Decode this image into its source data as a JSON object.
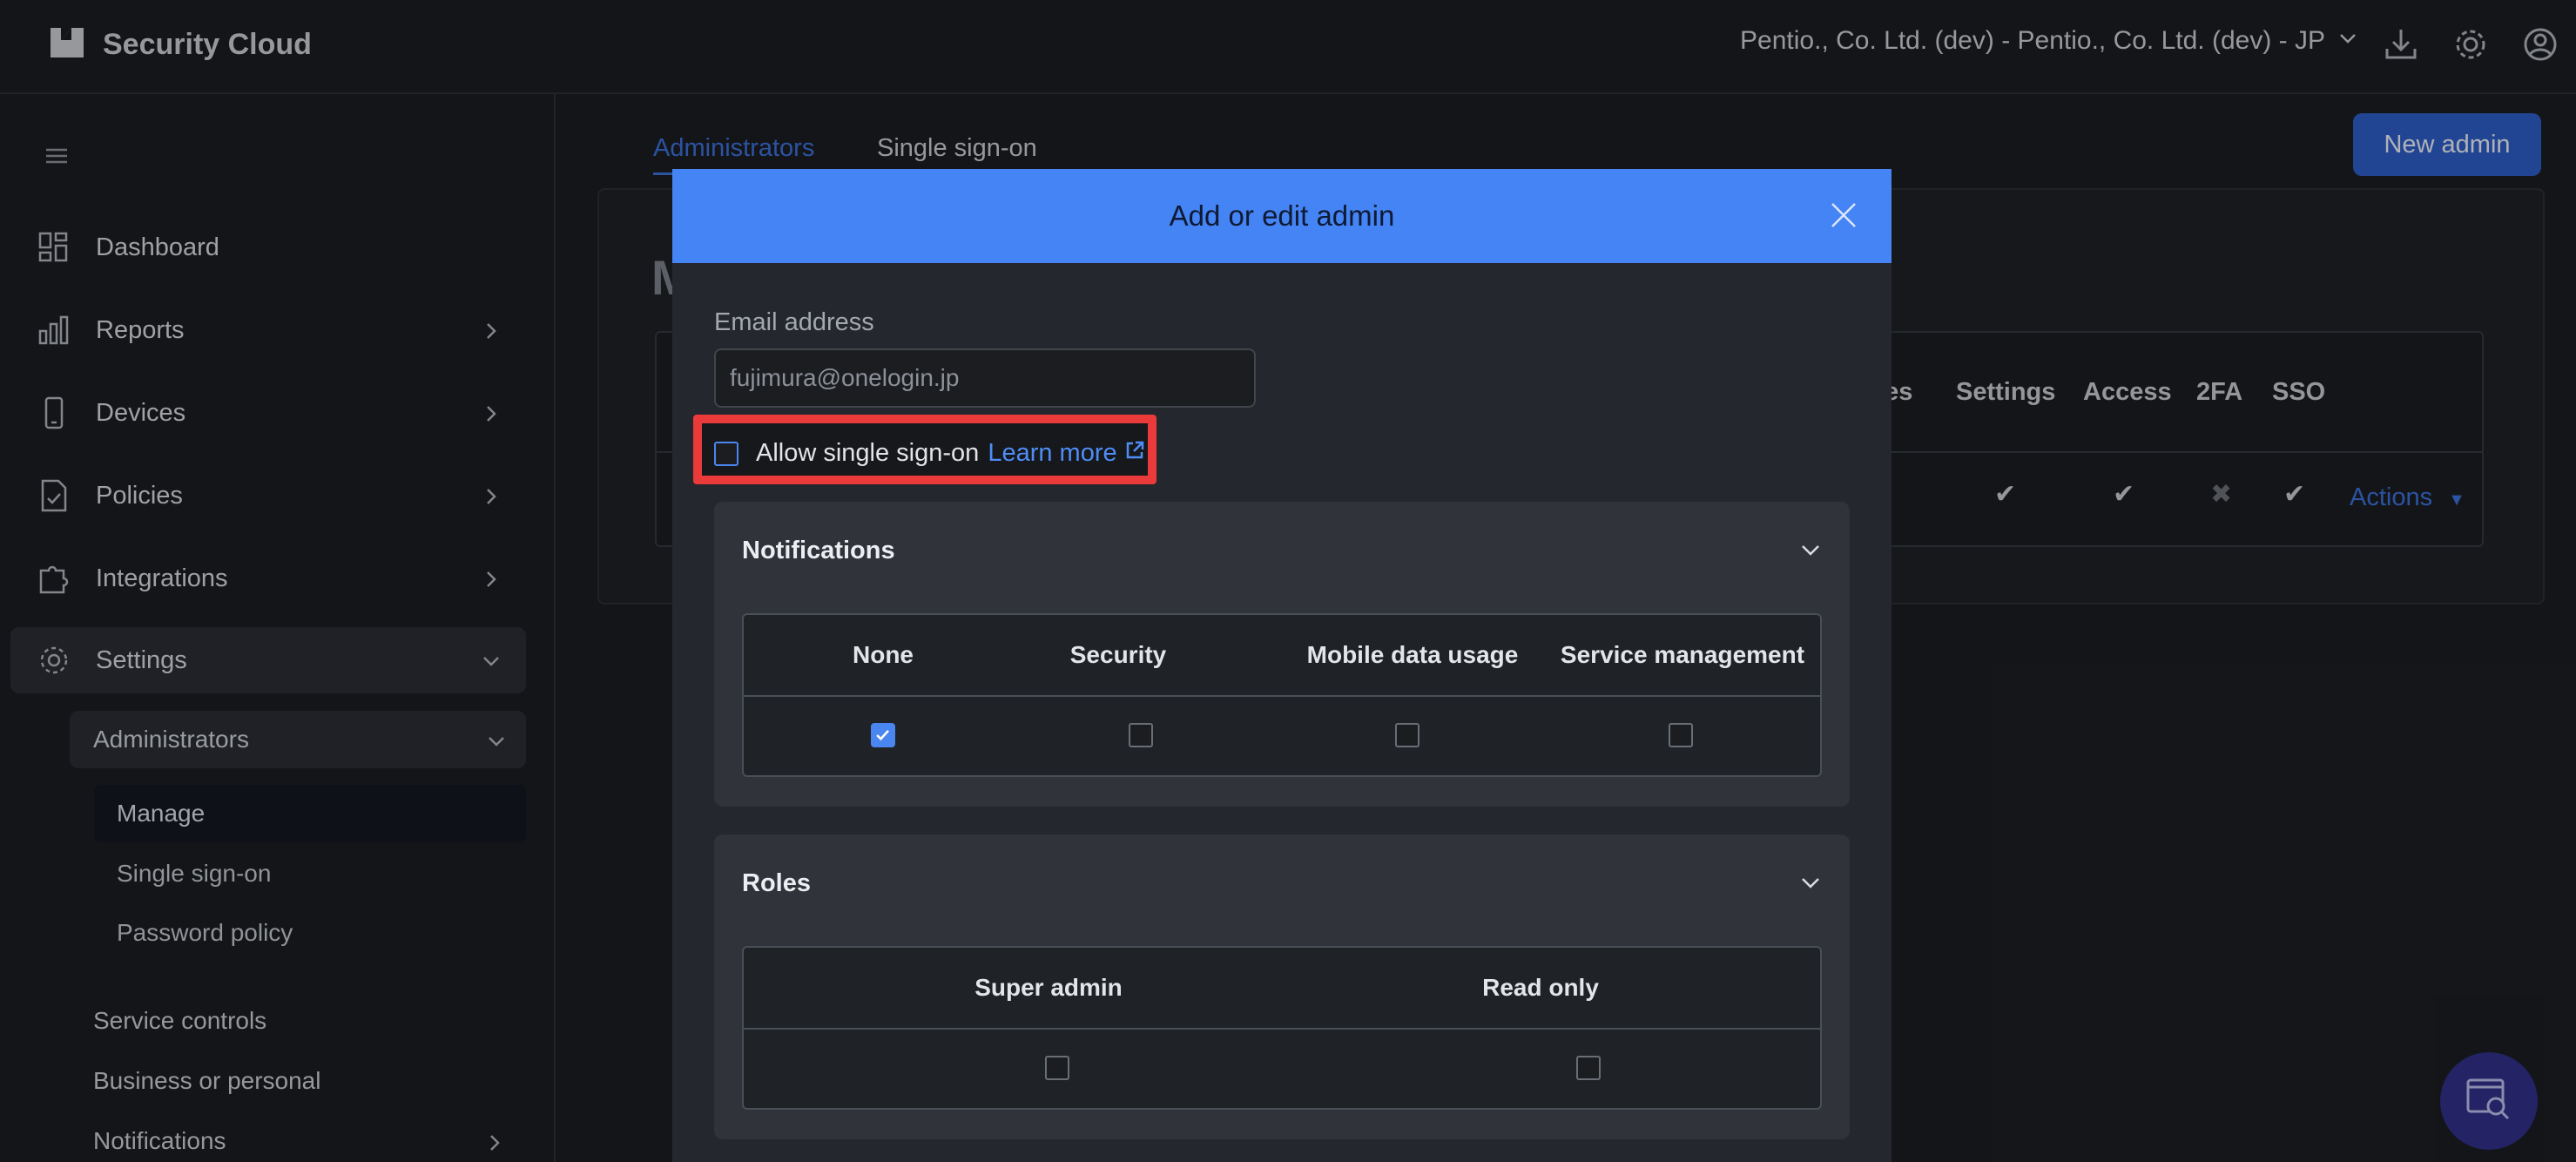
{
  "topbar": {
    "brand": "Security Cloud",
    "org_label": "Pentio., Co. Ltd. (dev) - Pentio., Co. Ltd. (dev) - JP"
  },
  "sidebar": {
    "items": [
      {
        "label": "Dashboard",
        "icon": "dashboard-icon"
      },
      {
        "label": "Reports",
        "icon": "bar-chart-icon"
      },
      {
        "label": "Devices",
        "icon": "phone-icon"
      },
      {
        "label": "Policies",
        "icon": "policy-doc-icon"
      },
      {
        "label": "Integrations",
        "icon": "puzzle-icon"
      },
      {
        "label": "Settings",
        "icon": "gear-icon"
      }
    ],
    "administrators_label": "Administrators",
    "admin_sub": [
      "Manage",
      "Single sign-on",
      "Password policy"
    ],
    "more": [
      "Service controls",
      "Business or personal",
      "Notifications"
    ]
  },
  "main": {
    "tabs": [
      "Administrators",
      "Single sign-on"
    ],
    "new_admin": "New admin",
    "heading_fragment": "M",
    "columns": [
      "ces",
      "Settings",
      "Access",
      "2FA",
      "SSO"
    ],
    "actions": "Actions"
  },
  "modal": {
    "title": "Add or edit admin",
    "email_label": "Email address",
    "email_placeholder": "fujimura@onelogin.jp",
    "sso_label": "Allow single sign-on",
    "learn_more": "Learn more",
    "notifications": {
      "title": "Notifications",
      "columns": [
        "None",
        "Security",
        "Mobile data usage",
        "Service management"
      ],
      "checked": [
        true,
        false,
        false,
        false
      ]
    },
    "roles": {
      "title": "Roles",
      "columns": [
        "Super admin",
        "Read only"
      ],
      "checked": [
        false,
        false
      ]
    }
  },
  "colors": {
    "accent": "#4584f4",
    "highlight": "#ea3a3a",
    "link": "#4f8df5"
  }
}
